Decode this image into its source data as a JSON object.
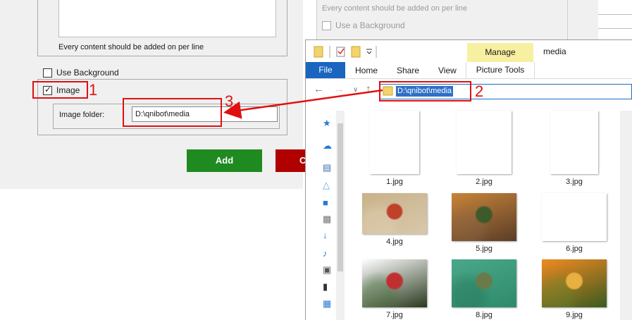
{
  "left_dialog": {
    "content_note": "Every content should be added on per line",
    "use_background_label": "Use Background",
    "image_label": "Image",
    "image_checked": true,
    "image_folder_label": "Image folder:",
    "image_folder_value": "D:\\qnibot\\media",
    "add_button": "Add",
    "cancel_button_partial": "C"
  },
  "right_dialog": {
    "content_note": "Every content should be added on per line",
    "use_background_label": "Use a Background"
  },
  "explorer": {
    "manage_tab": "Manage",
    "window_title": "media",
    "tabs": [
      "File",
      "Home",
      "Share",
      "View",
      "Picture Tools"
    ],
    "address": "D:\\qnibot\\media",
    "files": [
      {
        "name": "1.jpg"
      },
      {
        "name": "2.jpg"
      },
      {
        "name": "3.jpg"
      },
      {
        "name": "4.jpg"
      },
      {
        "name": "5.jpg"
      },
      {
        "name": "6.jpg"
      },
      {
        "name": "7.jpg"
      },
      {
        "name": "8.jpg"
      },
      {
        "name": "9.jpg"
      }
    ]
  },
  "annotations": {
    "step1": "1",
    "step2": "2",
    "step3": "3",
    "color": "#e01010"
  }
}
